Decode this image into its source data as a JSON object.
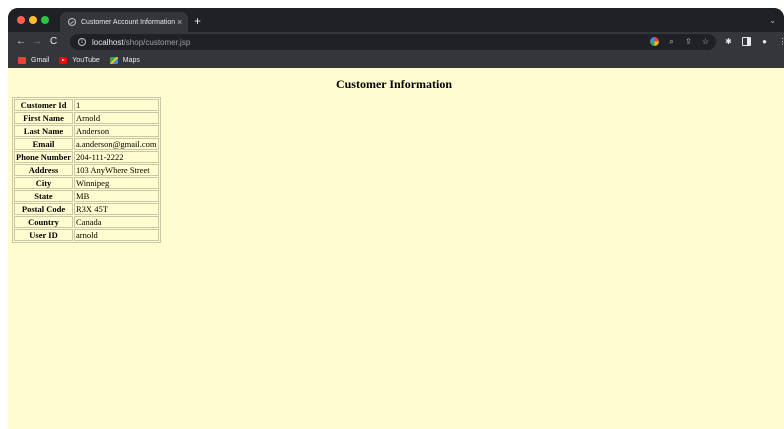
{
  "browser": {
    "tab": {
      "title": "Customer Account Information",
      "close": "×"
    },
    "new_tab": "+",
    "tab_menu": "⌄",
    "nav": {
      "back": "←",
      "forward": "→",
      "reload": "C"
    },
    "address": {
      "host": "localhost",
      "path": "/shop/customer.jsp"
    },
    "bookmarks": [
      {
        "label": "Gmail",
        "icon": "gmail-icon"
      },
      {
        "label": "YouTube",
        "icon": "youtube-icon"
      },
      {
        "label": "Maps",
        "icon": "maps-icon"
      }
    ]
  },
  "page": {
    "title": "Customer Information",
    "rows": [
      {
        "label": "Customer Id",
        "value": "1"
      },
      {
        "label": "First Name",
        "value": "Arnold"
      },
      {
        "label": "Last Name",
        "value": "Anderson"
      },
      {
        "label": "Email",
        "value": "a.anderson@gmail.com"
      },
      {
        "label": "Phone Number",
        "value": "204-111-2222"
      },
      {
        "label": "Address",
        "value": "103 AnyWhere Street"
      },
      {
        "label": "City",
        "value": "Winnipeg"
      },
      {
        "label": "State",
        "value": "MB"
      },
      {
        "label": "Postal Code",
        "value": "R3X 45T"
      },
      {
        "label": "Country",
        "value": "Canada"
      },
      {
        "label": "User ID",
        "value": "arnold"
      }
    ]
  },
  "colors": {
    "page_background": "#fffdd0",
    "chrome_dark": "#202124",
    "chrome_toolbar": "#35363a"
  }
}
